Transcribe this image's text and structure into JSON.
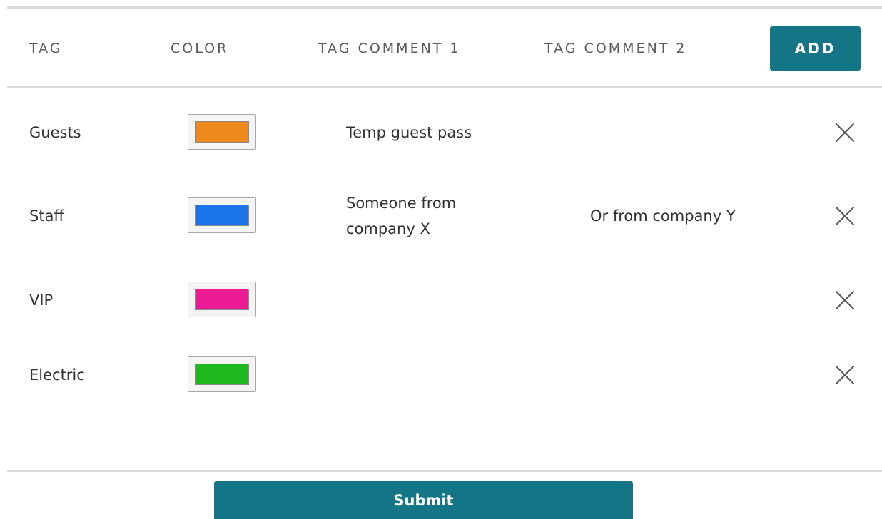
{
  "header": {
    "tag_label": "TAG",
    "color_label": "COLOR",
    "comment1_label": "TAG COMMENT 1",
    "comment2_label": "TAG COMMENT 2",
    "add_label": "ADD"
  },
  "rows": [
    {
      "tag": "Guests",
      "color": "#ee8a1c",
      "comment1": "Temp guest pass",
      "comment2": ""
    },
    {
      "tag": "Staff",
      "color": "#1b74e8",
      "comment1": "Someone from company X",
      "comment2": "Or from company Y"
    },
    {
      "tag": "VIP",
      "color": "#ec1c94",
      "comment1": "",
      "comment2": ""
    },
    {
      "tag": "Electric",
      "color": "#1fb81f",
      "comment1": "",
      "comment2": ""
    }
  ],
  "icons": {
    "remove": "close-icon"
  },
  "colors": {
    "accent": "#137585",
    "divider": "#dcdcdc"
  },
  "footer": {
    "submit_label": "Submit"
  }
}
